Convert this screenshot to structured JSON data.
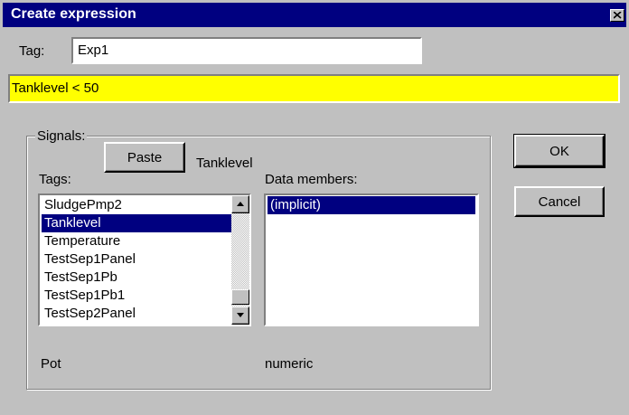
{
  "dialog": {
    "title": "Create expression",
    "close_icon": "close-icon"
  },
  "tag": {
    "label": "Tag:",
    "value": "Exp1"
  },
  "expression": {
    "value": "Tanklevel < 50",
    "background_color": "#ffff00"
  },
  "signals": {
    "group_label": "Signals:",
    "paste_label": "Paste",
    "selected_signal": "Tanklevel",
    "tags_label": "Tags:",
    "tags": [
      {
        "label": "SludgePmp2",
        "selected": false
      },
      {
        "label": "Tanklevel",
        "selected": true
      },
      {
        "label": "Temperature",
        "selected": false
      },
      {
        "label": "TestSep1Panel",
        "selected": false
      },
      {
        "label": "TestSep1Pb",
        "selected": false
      },
      {
        "label": "TestSep1Pb1",
        "selected": false
      },
      {
        "label": "TestSep2Panel",
        "selected": false
      }
    ],
    "data_members_label": "Data members:",
    "data_members": [
      {
        "label": "(implicit)",
        "selected": true
      }
    ],
    "footer_left": "Pot",
    "footer_right": "numeric"
  },
  "buttons": {
    "ok": "OK",
    "cancel": "Cancel"
  },
  "colors": {
    "selection": "#000080",
    "face": "#c0c0c0"
  }
}
